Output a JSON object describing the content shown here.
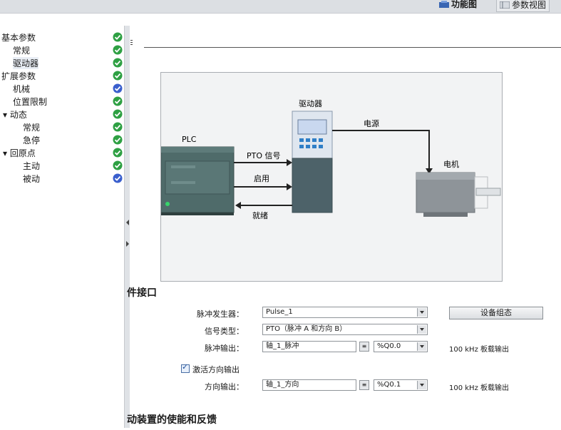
{
  "toolbar": {
    "tab_function": "功能图",
    "tab_parameter": "参数视图"
  },
  "nav": {
    "items": [
      {
        "label": "基本参数",
        "status": "green"
      },
      {
        "label": "常规",
        "status": "green"
      },
      {
        "label": "驱动器",
        "status": "green"
      },
      {
        "label": "扩展参数",
        "status": "green"
      },
      {
        "label": "机械",
        "status": "blue"
      },
      {
        "label": "位置限制",
        "status": "green"
      },
      {
        "label": "▾ 动态",
        "status": "green"
      },
      {
        "label": "常规",
        "status": "green"
      },
      {
        "label": "急停",
        "status": "green"
      },
      {
        "label": "▾ 回原点",
        "status": "green"
      },
      {
        "label": "主动",
        "status": "green"
      },
      {
        "label": "被动",
        "status": "blue"
      }
    ]
  },
  "diagram": {
    "plc_label": "PLC",
    "drive_label": "驱动器",
    "motor_label": "电机",
    "power_label": "电源",
    "pto_label": "PTO 信号",
    "enable_label": "启用",
    "ready_label": "就绪"
  },
  "section1": {
    "title": "件接口",
    "pulse_gen_label": "脉冲发生器：",
    "pulse_gen_value": "Pulse_1",
    "signal_type_label": "信号类型：",
    "signal_type_value": "PTO（脉冲 A 和方向 B）",
    "pulse_out_label": "脉冲输出：",
    "pulse_out_value": "轴_1_脉冲",
    "pulse_out_addr": "%Q0.0",
    "pulse_out_note": "100 kHz 板载输出",
    "device_config_button": "设备组态",
    "activate_dir_label": "激活方向输出",
    "activate_dir_checked": true,
    "dir_out_label": "方向输出：",
    "dir_out_value": "轴_1_方向",
    "dir_out_addr": "%Q0.1",
    "dir_out_note": "100 kHz 板载输出"
  },
  "section2": {
    "title": "动装置的使能和反馈"
  },
  "colors": {
    "ok_green": "#2ea043",
    "info_blue": "#3a5fcd"
  }
}
